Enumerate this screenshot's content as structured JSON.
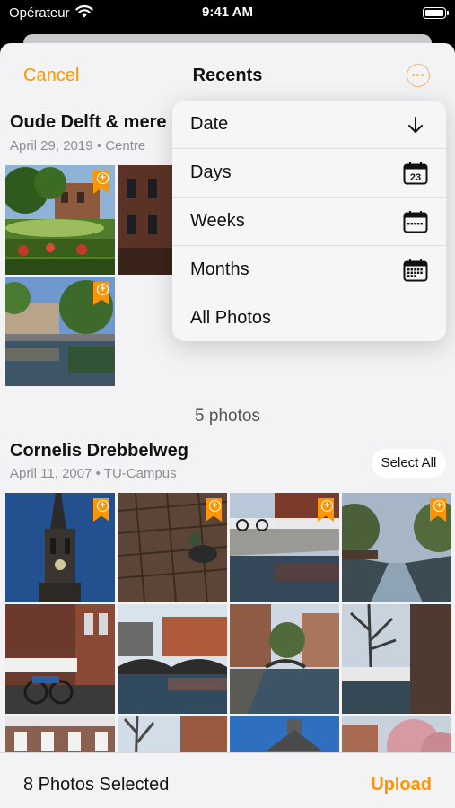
{
  "status_bar": {
    "carrier": "Opérateur",
    "time": "9:41 AM"
  },
  "nav": {
    "cancel_label": "Cancel",
    "title": "Recents"
  },
  "sections": [
    {
      "title": "Oude Delft & mere",
      "date": "April 29, 2019",
      "separator": "•",
      "place": "Centre"
    },
    {
      "title": "Cornelis Drebbelweg",
      "date": "April 11, 2007",
      "separator": "•",
      "place": "TU-Campus",
      "select_all_label": "Select All"
    }
  ],
  "section1_count_label": "5 photos",
  "menu": {
    "items": [
      {
        "label": "Date",
        "icon": "arrow-down-icon"
      },
      {
        "label": "Days",
        "icon": "calendar-day-icon",
        "icon_text": "23"
      },
      {
        "label": "Weeks",
        "icon": "calendar-week-icon"
      },
      {
        "label": "Months",
        "icon": "calendar-month-icon"
      },
      {
        "label": "All Photos"
      }
    ]
  },
  "toolbar": {
    "selected_label": "8 Photos Selected",
    "upload_label": "Upload"
  },
  "colors": {
    "accent": "#ff9500",
    "background": "#f3f3f5",
    "menu_background": "#f6f6f8"
  }
}
